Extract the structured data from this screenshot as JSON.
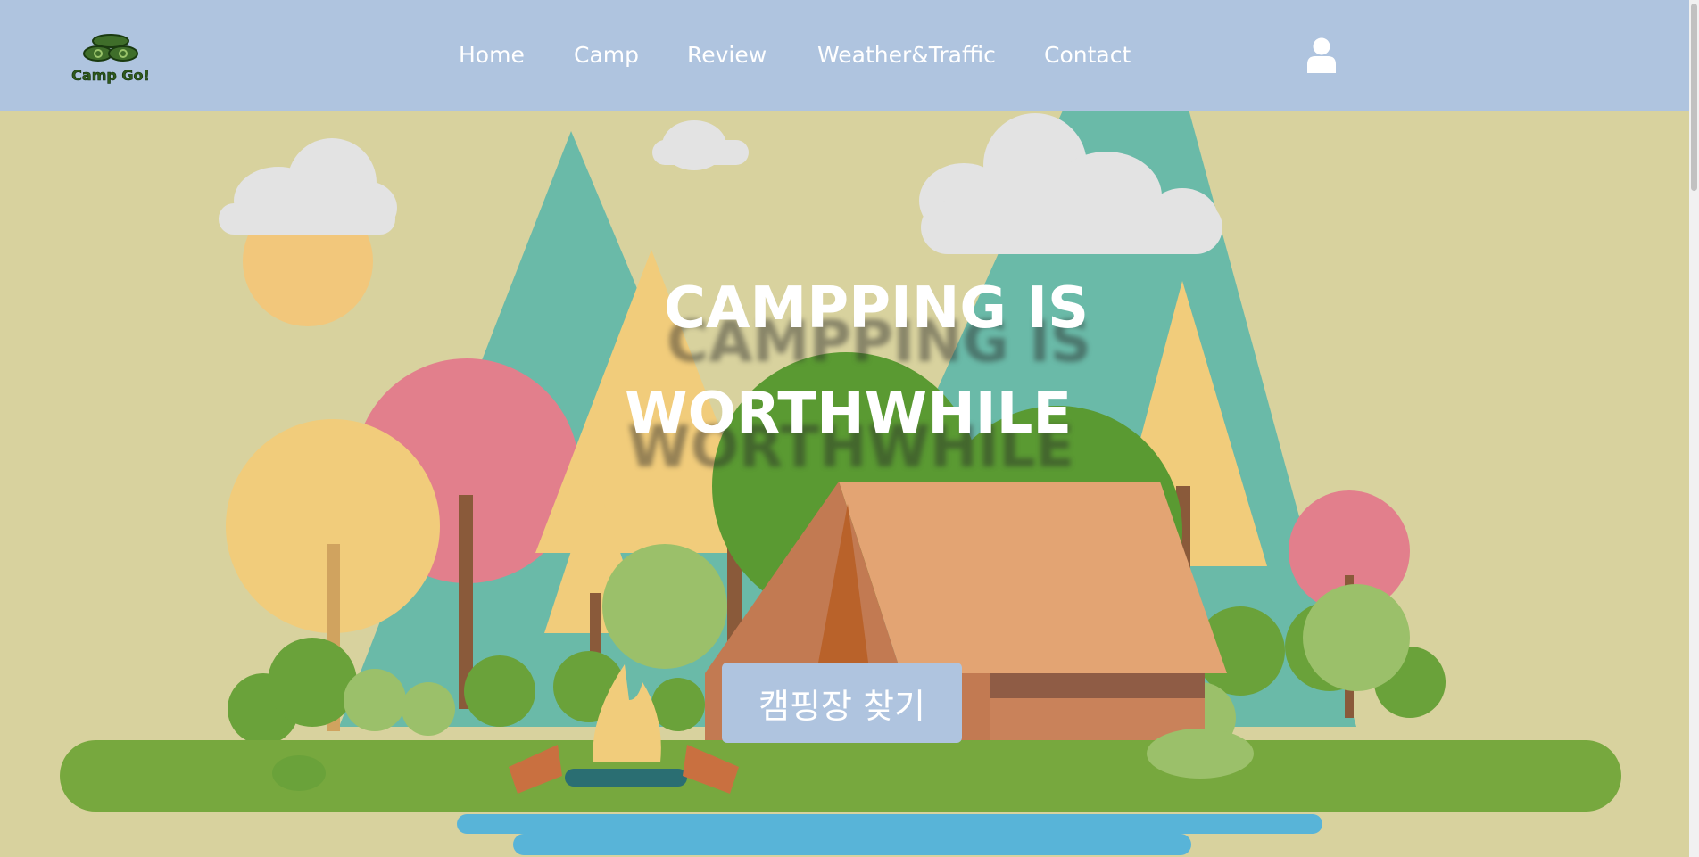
{
  "brand": {
    "logo_text": "Camp Go!"
  },
  "nav": {
    "items": [
      {
        "label": "Home"
      },
      {
        "label": "Camp"
      },
      {
        "label": "Review"
      },
      {
        "label": "Weather&Traffic"
      },
      {
        "label": "Contact"
      }
    ],
    "user_icon": "user-icon"
  },
  "hero": {
    "title_line1": "CAMPPING IS",
    "title_line2": "WORTHWHILE",
    "cta_label": "캠핑장 찾기"
  },
  "colors": {
    "header_bg": "#afc4df",
    "hero_bg": "#d8d29e",
    "button_bg": "#afc4df"
  }
}
